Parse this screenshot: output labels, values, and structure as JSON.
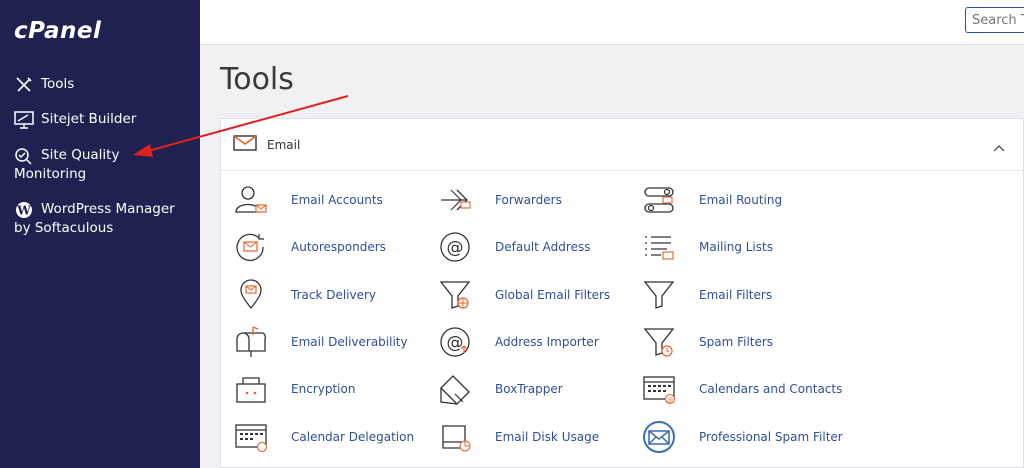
{
  "brand": {
    "logo_text": "cPanel"
  },
  "sidebar": {
    "items": [
      {
        "label": "Tools",
        "icon": "tools-icon"
      },
      {
        "label": "Sitejet Builder",
        "icon": "monitor-icon"
      },
      {
        "label_line1": "Site Quality",
        "label_line2": "Monitoring",
        "icon": "search-check-icon"
      },
      {
        "label_line1": "WordPress Manager",
        "label_line2": "by Softaculous",
        "icon": "wordpress-icon"
      }
    ]
  },
  "header": {
    "search_placeholder": "Search Tools"
  },
  "page": {
    "title": "Tools"
  },
  "email_section": {
    "title": "Email",
    "tools": [
      {
        "label": "Email Accounts",
        "icon": "email-accounts-icon"
      },
      {
        "label": "Forwarders",
        "icon": "forwarders-icon"
      },
      {
        "label": "Email Routing",
        "icon": "email-routing-icon"
      },
      {
        "label": "Autoresponders",
        "icon": "autoresponders-icon"
      },
      {
        "label": "Default Address",
        "icon": "default-address-icon"
      },
      {
        "label": "Mailing Lists",
        "icon": "mailing-lists-icon"
      },
      {
        "label": "Track Delivery",
        "icon": "track-delivery-icon"
      },
      {
        "label": "Global Email Filters",
        "icon": "global-filters-icon"
      },
      {
        "label": "Email Filters",
        "icon": "email-filters-icon"
      },
      {
        "label": "Email Deliverability",
        "icon": "deliverability-icon"
      },
      {
        "label": "Address Importer",
        "icon": "address-importer-icon"
      },
      {
        "label": "Spam Filters",
        "icon": "spam-filters-icon"
      },
      {
        "label": "Encryption",
        "icon": "encryption-icon"
      },
      {
        "label": "BoxTrapper",
        "icon": "boxtrapper-icon"
      },
      {
        "label": "Calendars and Contacts",
        "icon": "calendars-icon"
      },
      {
        "label": "Calendar Delegation",
        "icon": "calendar-delegation-icon"
      },
      {
        "label": "Email Disk Usage",
        "icon": "disk-usage-icon"
      },
      {
        "label": "Professional Spam Filter",
        "icon": "pro-spam-filter-icon"
      }
    ]
  },
  "colors": {
    "sidebar_bg": "#1f2250",
    "link": "#2f4f9a",
    "accent_orange": "#e8622c",
    "arrow_red": "#e0201e"
  }
}
